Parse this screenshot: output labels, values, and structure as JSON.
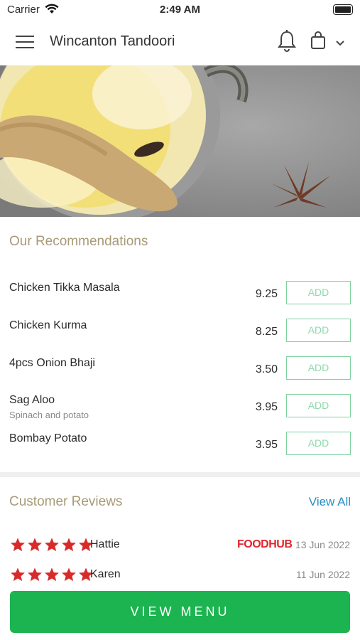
{
  "status_bar": {
    "carrier": "Carrier",
    "time": "2:49 AM"
  },
  "header": {
    "title": "Wincanton Tandoori",
    "icons": [
      "menu-icon",
      "bell-icon",
      "bag-icon",
      "chevron-down-icon"
    ]
  },
  "recommendations": {
    "title": "Our Recommendations",
    "items": [
      {
        "name": "Chicken Tikka Masala",
        "description": "",
        "price": "9.25",
        "add_label": "ADD"
      },
      {
        "name": "Chicken Kurma",
        "description": "",
        "price": "8.25",
        "add_label": "ADD"
      },
      {
        "name": "4pcs Onion Bhaji",
        "description": "",
        "price": "3.50",
        "add_label": "ADD"
      },
      {
        "name": "Sag Aloo",
        "description": "Spinach and potato",
        "price": "3.95",
        "add_label": "ADD"
      },
      {
        "name": "Bombay Potato",
        "description": "",
        "price": "3.95",
        "add_label": "ADD"
      }
    ]
  },
  "reviews": {
    "title": "Customer Reviews",
    "view_all": "View All",
    "items": [
      {
        "rating": 5,
        "name": "Hattie",
        "source": "FOODHUB",
        "date": "13 Jun 2022"
      },
      {
        "rating": 5,
        "name": "Karen",
        "source": "",
        "date": "11 Jun 2022"
      }
    ]
  },
  "view_menu_label": "VIEW MENU",
  "colors": {
    "accent_green": "#1cb450",
    "add_border": "#7fd1a0",
    "section_title": "#a89a78",
    "link": "#2a8fc6",
    "star": "#d82a2a",
    "foodhub": "#e0262e"
  }
}
